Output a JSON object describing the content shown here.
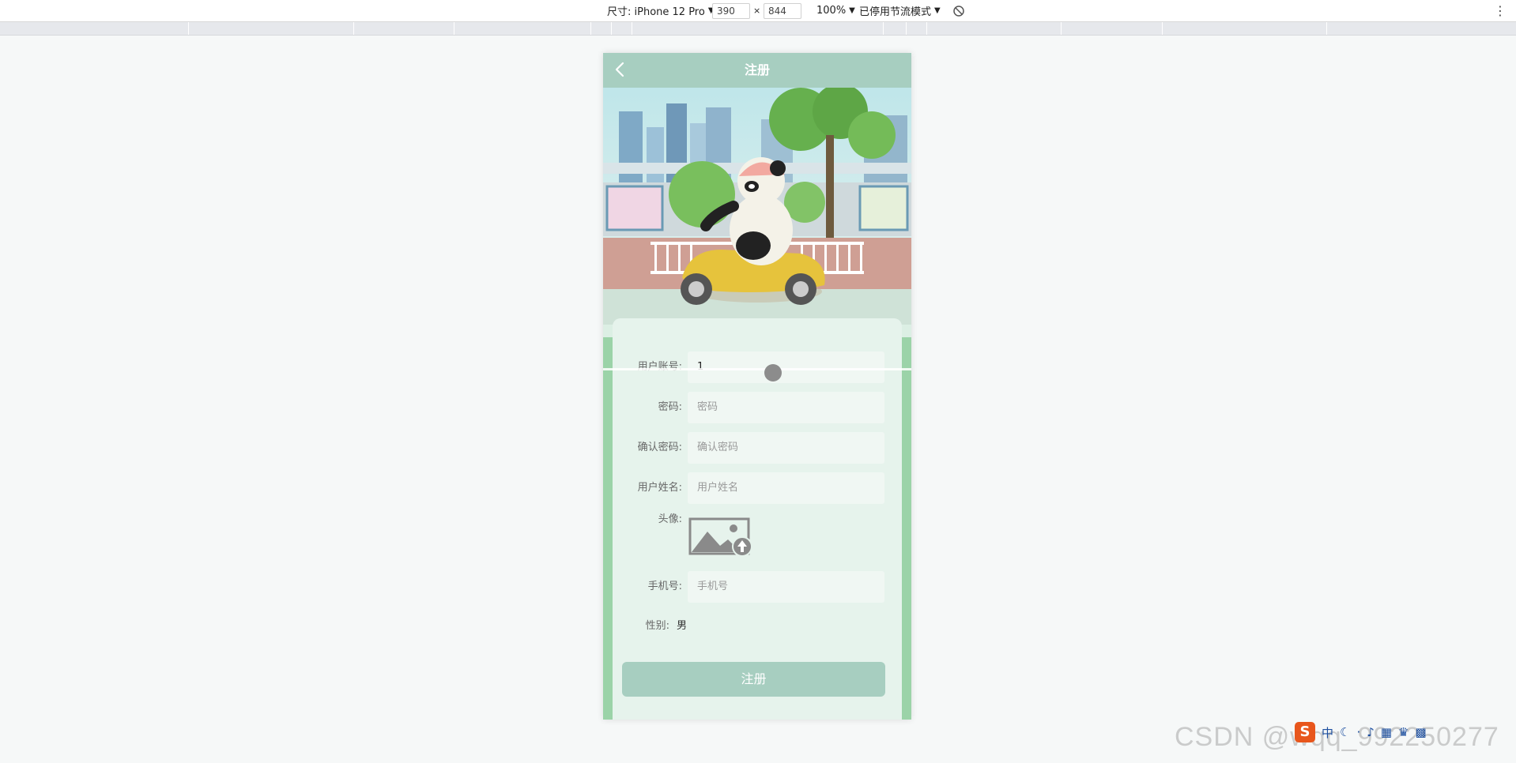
{
  "devtools": {
    "device_label": "尺寸: iPhone 12 Pro",
    "width": "390",
    "times": "×",
    "height": "844",
    "zoom": "100%",
    "throttle": "已停用节流模式"
  },
  "app": {
    "nav_title": "注册",
    "form": {
      "account_label": "用户账号:",
      "account_value": "1",
      "password_label": "密码:",
      "password_placeholder": "密码",
      "confirm_label": "确认密码:",
      "confirm_placeholder": "确认密码",
      "name_label": "用户姓名:",
      "name_placeholder": "用户姓名",
      "avatar_label": "头像:",
      "phone_label": "手机号:",
      "phone_placeholder": "手机号",
      "gender_label": "性别:",
      "gender_value": "男"
    },
    "submit_label": "注册"
  },
  "watermark": "CSDN @wqq_992250277",
  "colors": {
    "accent": "#a7cec0",
    "card": "#e6f3ec",
    "background": "#dcefe4"
  }
}
